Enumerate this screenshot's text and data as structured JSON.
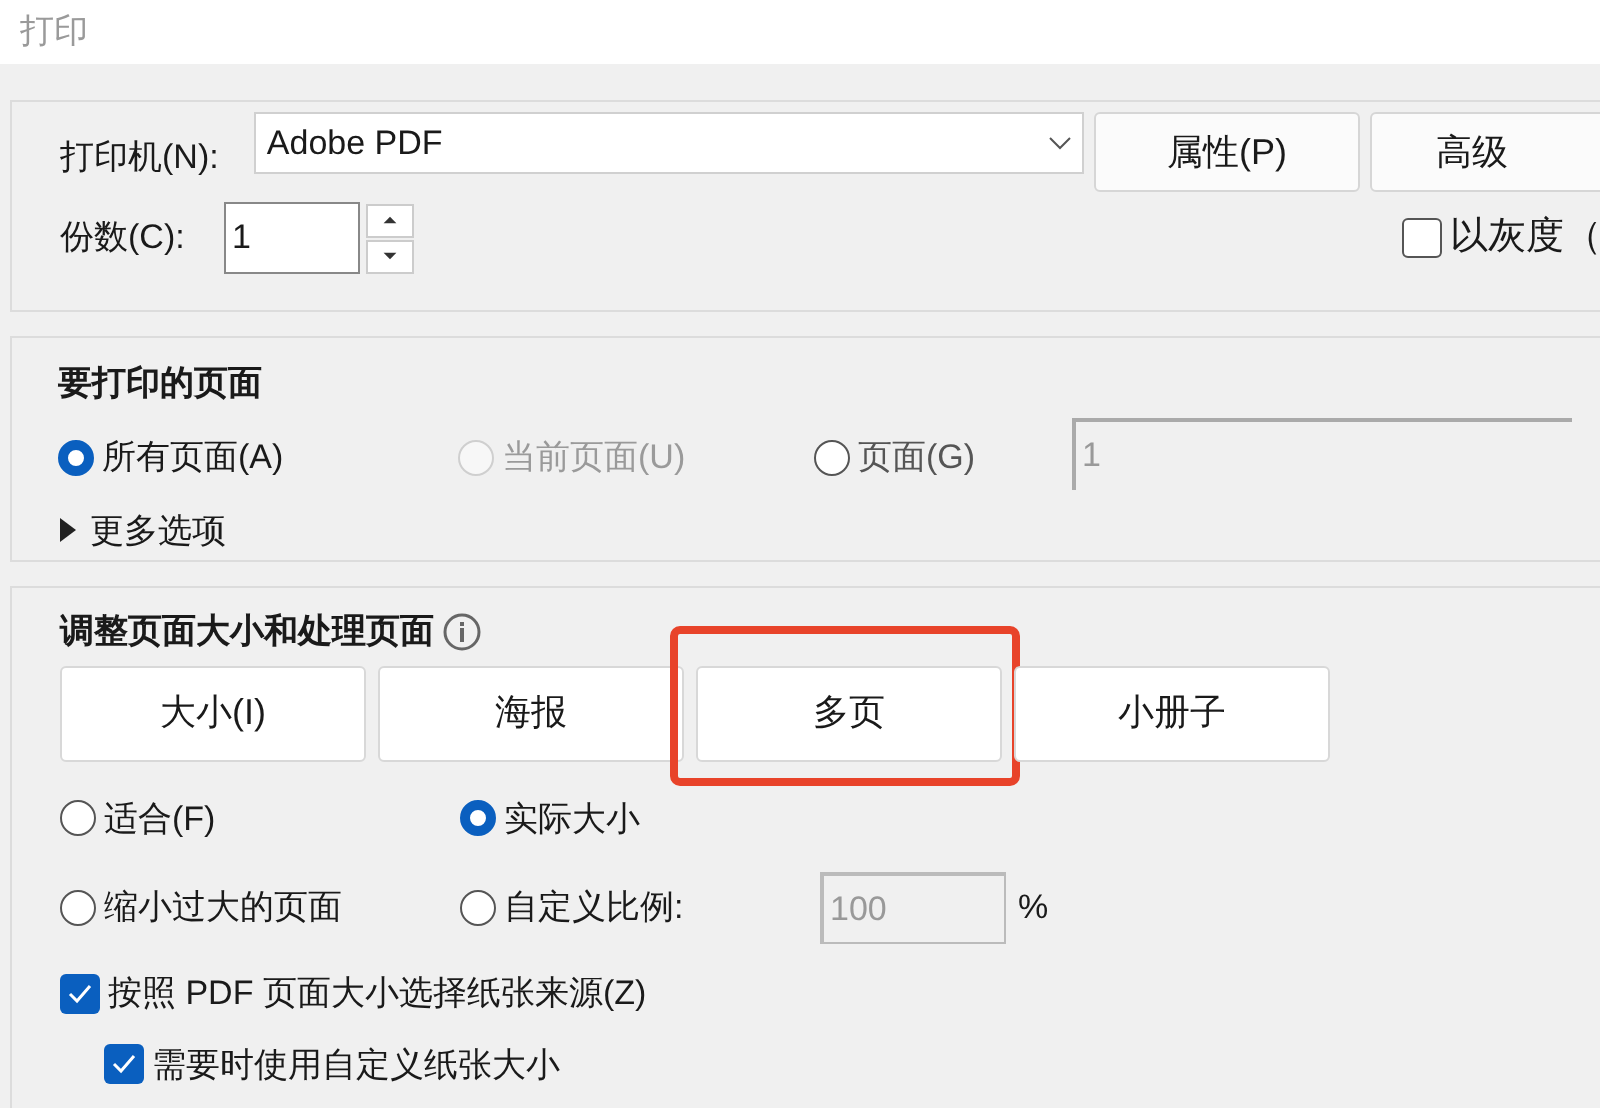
{
  "window": {
    "title": "打印"
  },
  "printer": {
    "label": "打印机(N):",
    "value": "Adobe PDF",
    "buttons": [
      "属性(P)",
      "高级"
    ]
  },
  "copies": {
    "label": "份数(C):",
    "value": "1"
  },
  "grayscale": {
    "label": "以灰度（",
    "checked": false
  },
  "pages_to_print": {
    "title": "要打印的页面",
    "options": [
      {
        "label": "所有页面(A)",
        "selected": true,
        "disabled": false
      },
      {
        "label": "当前页面(U)",
        "selected": false,
        "disabled": true
      },
      {
        "label": "页面(G)",
        "selected": false,
        "disabled": false
      }
    ],
    "range": {
      "value": "1",
      "disabled": true
    },
    "more_options": {
      "label": "更多选项",
      "expanded": false
    }
  },
  "page_sizing": {
    "title": "调整页面大小和处理页面",
    "modes": [
      {
        "label": "大小(I)",
        "highlighted": false
      },
      {
        "label": "海报",
        "highlighted": false
      },
      {
        "label": "多页",
        "highlighted": true
      },
      {
        "label": "小册子",
        "highlighted": false
      }
    ],
    "scale_options": [
      {
        "label": "适合(F)",
        "selected": false
      },
      {
        "label": "实际大小",
        "selected": true
      },
      {
        "label": "缩小过大的页面",
        "selected": false
      },
      {
        "label": "自定义比例:",
        "selected": false
      }
    ],
    "custom_scale": {
      "value": "100",
      "unit": "%",
      "disabled": true
    },
    "checkboxes": [
      {
        "label": "按照 PDF 页面大小选择纸张来源(Z)",
        "checked": true
      },
      {
        "label": "需要时使用自定义纸张大小",
        "checked": true
      }
    ]
  }
}
